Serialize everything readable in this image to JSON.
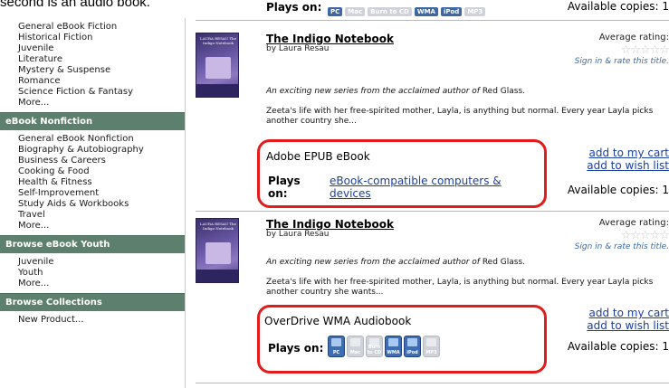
{
  "caption": "second is an audio book.",
  "top_row": {
    "plays_on": "Plays on:",
    "badges": [
      {
        "label": "PC",
        "on": true
      },
      {
        "label": "Mac",
        "on": false
      },
      {
        "label": "Burn to CD",
        "on": false
      },
      {
        "label": "WMA",
        "on": true
      },
      {
        "label": "iPod",
        "on": true
      },
      {
        "label": "MP3",
        "on": false
      }
    ],
    "available": "Available copies: 1"
  },
  "sidebar": {
    "group1_items": [
      "General eBook Fiction",
      "Historical Fiction",
      "Juvenile",
      "Literature",
      "Mystery & Suspense",
      "Romance",
      "Science Fiction & Fantasy",
      "More..."
    ],
    "header_nonfiction": "eBook Nonfiction",
    "nonfiction_items": [
      "General eBook Nonfiction",
      "Biography & Autobiography",
      "Business & Careers",
      "Cooking & Food",
      "Health & Fitness",
      "Self-Improvement",
      "Study Aids & Workbooks",
      "Travel",
      "More..."
    ],
    "header_youth": "Browse eBook Youth",
    "youth_items": [
      "Juvenile",
      "Youth",
      "More..."
    ],
    "header_collections": "Browse Collections",
    "collections_items": [
      "New Product..."
    ]
  },
  "items": [
    {
      "cover_text": "LAURA RESAU The Indigo Notebook",
      "title": "The Indigo Notebook",
      "author": "by Laura Resau",
      "rating_label": "Average rating:",
      "stars": "☆☆☆☆☆",
      "signin": "Sign in & rate this title.",
      "tagline_a": "An exciting new series from the acclaimed author of ",
      "tagline_b": "Red Glass.",
      "desc": "Zeeta's life with her free-spirited mother, Layla, is anything but normal. Every year Layla picks another country she...",
      "format": "Adobe EPUB eBook",
      "plays_on": "Plays on:",
      "plays_link": "eBook-compatible computers & devices",
      "add_cart": "add to my cart",
      "add_wish": "add to wish list",
      "available": "Available copies: 1"
    },
    {
      "cover_text": "LAURA RESAU The Indigo Notebook",
      "title": "The Indigo Notebook",
      "author": "by Laura Resau",
      "rating_label": "Average rating:",
      "stars": "☆☆☆☆☆",
      "signin": "Sign in & rate this title.",
      "tagline_a": "An exciting new series from the acclaimed author of ",
      "tagline_b": "Red Glass.",
      "desc": "Zeeta's life with her free-spirited mother, Layla, is anything but normal. Every year Layla picks another country she wants...",
      "format": "OverDrive WMA Audiobook",
      "plays_on": "Plays on:",
      "platforms": [
        {
          "label": "PC",
          "on": true
        },
        {
          "label": "Mac",
          "on": false
        },
        {
          "label": "Burn to CD",
          "on": false
        },
        {
          "label": "WMA",
          "on": true
        },
        {
          "label": "iPod",
          "on": true
        },
        {
          "label": "MP3",
          "on": false
        }
      ],
      "add_cart": "add to my cart",
      "add_wish": "add to wish list",
      "available": "Available copies: 1"
    }
  ],
  "colors": {
    "highlight": "#e21b1b",
    "link": "#1a3fa6",
    "sidebar_header": "#5c7f6e"
  }
}
